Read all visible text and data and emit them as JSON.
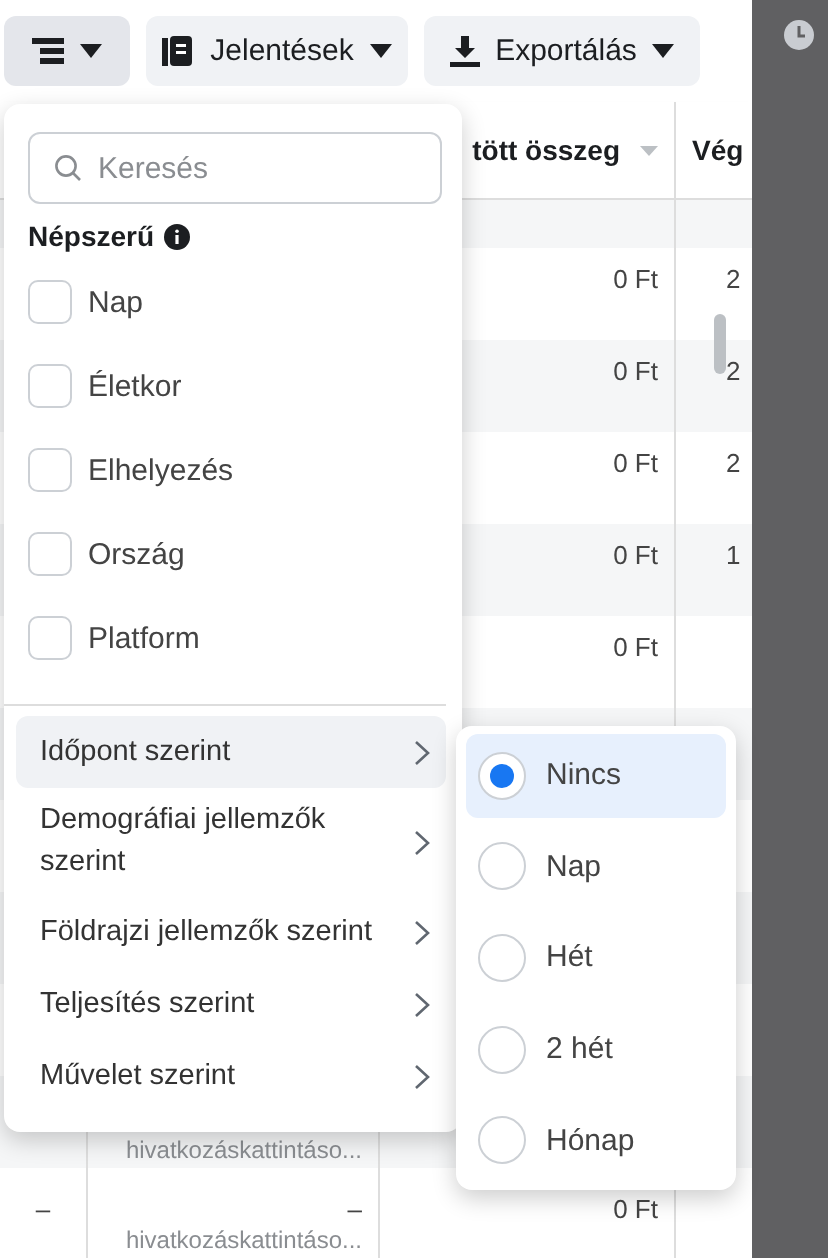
{
  "toolbar": [
    {
      "kind": "breakdown"
    },
    {
      "kind": "reports",
      "label": "Jelentések"
    },
    {
      "kind": "export",
      "label": "Exportálás"
    }
  ],
  "table": {
    "columns": [
      "tött összeg",
      "Vég"
    ],
    "rows": [
      {
        "amount": "0 Ft",
        "next": "2"
      },
      {
        "amount": "0 Ft",
        "next": "2"
      },
      {
        "amount": "0 Ft",
        "next": "2"
      },
      {
        "amount": "0 Ft",
        "next": "1"
      },
      {
        "amount": "0 Ft"
      },
      {},
      {},
      {},
      {},
      {
        "note": "hivatkozáskattintáso..."
      },
      {
        "first": "–",
        "second": "–",
        "note": "hivatkozáskattintáso...",
        "amount": "0 Ft"
      }
    ]
  },
  "breakdown_menu": {
    "search": {
      "placeholder": "Keresés"
    },
    "section": "Népszerű",
    "options": [
      {
        "label": "Nap",
        "checked": false
      },
      {
        "label": "Életkor",
        "checked": false
      },
      {
        "label": "Elhelyezés",
        "checked": false
      },
      {
        "label": "Ország",
        "checked": false
      },
      {
        "label": "Platform",
        "checked": false
      }
    ],
    "groups": [
      {
        "label": "Időpont szerint",
        "selected": true
      },
      {
        "label": "Demográfiai jellemzők szerint",
        "selected": false
      },
      {
        "label": "Földrajzi jellemzők szerint",
        "selected": false
      },
      {
        "label": "Teljesítés szerint",
        "selected": false
      },
      {
        "label": "Művelet szerint",
        "selected": false
      }
    ]
  },
  "time_menu": [
    {
      "label": "Nincs",
      "selected": true
    },
    {
      "label": "Nap",
      "selected": false
    },
    {
      "label": "Hét",
      "selected": false
    },
    {
      "label": "2 hét",
      "selected": false
    },
    {
      "label": "Hónap",
      "selected": false
    }
  ]
}
